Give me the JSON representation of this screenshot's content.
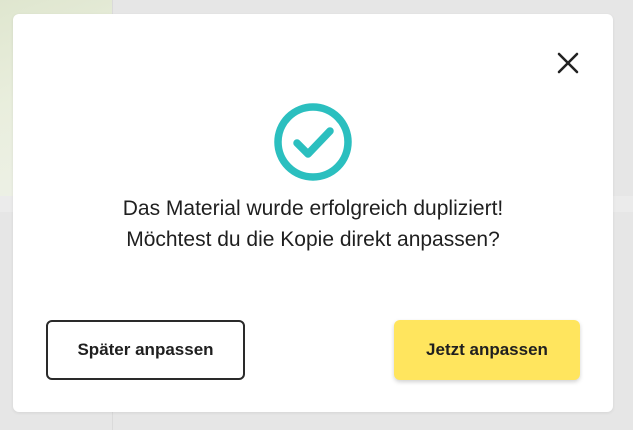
{
  "dialog": {
    "message_line1": "Das Material wurde erfolgreich dupliziert!",
    "message_line2": "Möchtest du die Kopie direkt anpassen?",
    "later_button_label": "Später anpassen",
    "now_button_label": "Jetzt anpassen",
    "close_icon": "close-icon",
    "status_icon": "check-circle-icon"
  },
  "colors": {
    "accent_success": "#2bbfbf",
    "primary_button": "#ffe55e",
    "text": "#1f1f1f",
    "backdrop": "#e6e6e6"
  }
}
